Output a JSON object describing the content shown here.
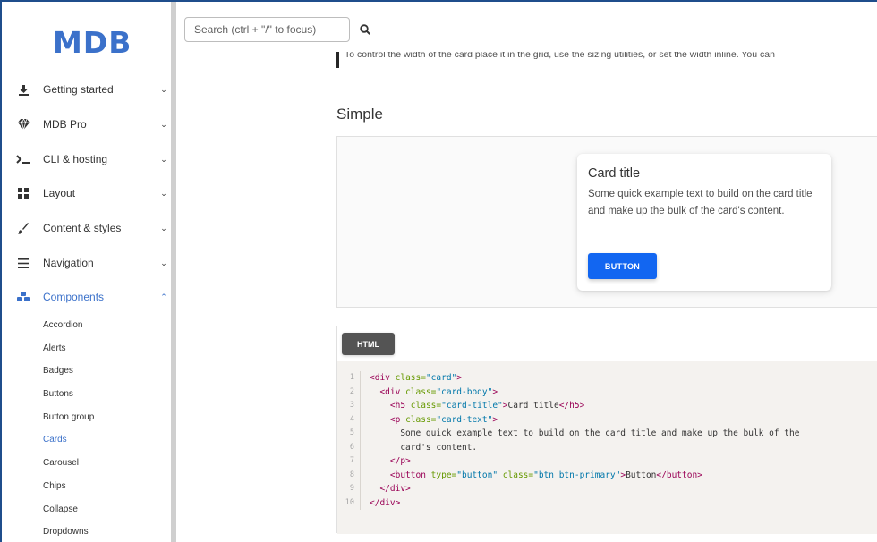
{
  "brand": {
    "logo_text": "MDB",
    "accent": "#3b71ca"
  },
  "search": {
    "placeholder": "Search (ctrl + \"/\" to focus)",
    "icon": "search-icon"
  },
  "sidebar": {
    "items": [
      {
        "label": "Getting started",
        "icon": "download-icon",
        "expanded": false
      },
      {
        "label": "MDB Pro",
        "icon": "gem-icon",
        "expanded": false
      },
      {
        "label": "CLI & hosting",
        "icon": "terminal-icon",
        "expanded": false
      },
      {
        "label": "Layout",
        "icon": "grid-icon",
        "expanded": false
      },
      {
        "label": "Content & styles",
        "icon": "brush-icon",
        "expanded": false
      },
      {
        "label": "Navigation",
        "icon": "bars-icon",
        "expanded": false
      },
      {
        "label": "Components",
        "icon": "cubes-icon",
        "expanded": true
      }
    ],
    "sub_items": [
      "Accordion",
      "Alerts",
      "Badges",
      "Buttons",
      "Button group",
      "Cards",
      "Carousel",
      "Chips",
      "Collapse",
      "Dropdowns"
    ],
    "active_sub_item": "Cards"
  },
  "main": {
    "note": "To control the width of the card place it in the grid, use the sizing utilities, or set the width inline. You can",
    "section_title": "Simple",
    "card": {
      "title": "Card title",
      "text": "Some quick example text to build on the card title and make up the bulk of the card's content.",
      "button_label": "BUTTON",
      "button_color": "#1266f1"
    },
    "code_tab_label": "HTML",
    "code_line_numbers": [
      "1",
      "2",
      "3",
      "4",
      "5",
      "6",
      "7",
      "8",
      "9",
      "10"
    ]
  }
}
